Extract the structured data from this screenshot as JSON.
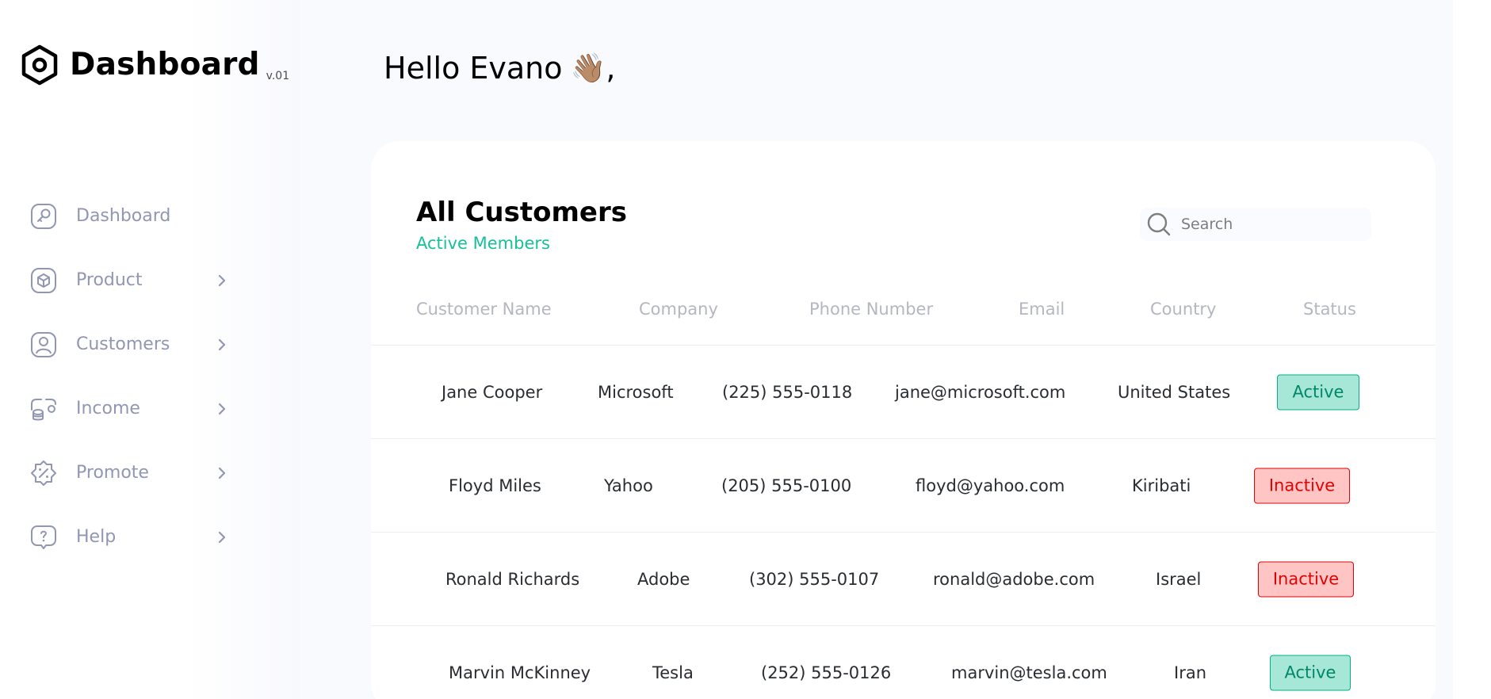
{
  "brand": {
    "title": "Dashboard",
    "version": "v.01"
  },
  "sidebar": {
    "items": [
      {
        "label": "Dashboard",
        "icon": "key-icon",
        "has_submenu": false
      },
      {
        "label": "Product",
        "icon": "cube-icon",
        "has_submenu": true
      },
      {
        "label": "Customers",
        "icon": "user-square-icon",
        "has_submenu": true
      },
      {
        "label": "Income",
        "icon": "wallet-money-icon",
        "has_submenu": true
      },
      {
        "label": "Promote",
        "icon": "discount-shape-icon",
        "has_submenu": true
      },
      {
        "label": "Help",
        "icon": "message-question-icon",
        "has_submenu": true
      }
    ],
    "label_color": "#9197b3"
  },
  "header": {
    "greeting": "Hello Evano",
    "emoji": "👋🏽",
    "suffix": ","
  },
  "customers": {
    "title": "All Customers",
    "subtitle": "Active Members",
    "search_placeholder": "Search",
    "columns": [
      "Customer Name",
      "Company",
      "Phone Number",
      "Email",
      "Country",
      "Status"
    ],
    "rows": [
      {
        "name": "Jane Cooper",
        "company": "Microsoft",
        "phone": "(225) 555-0118",
        "email": "jane@microsoft.com",
        "country": "United States",
        "status": "Active"
      },
      {
        "name": "Floyd Miles",
        "company": "Yahoo",
        "phone": "(205) 555-0100",
        "email": "floyd@yahoo.com",
        "country": "Kiribati",
        "status": "Inactive"
      },
      {
        "name": "Ronald Richards",
        "company": "Adobe",
        "phone": "(302) 555-0107",
        "email": "ronald@adobe.com",
        "country": "Israel",
        "status": "Inactive"
      },
      {
        "name": "Marvin McKinney",
        "company": "Tesla",
        "phone": "(252) 555-0126",
        "email": "marvin@tesla.com",
        "country": "Iran",
        "status": "Active"
      }
    ]
  },
  "colors": {
    "accent": "#16c098",
    "active_bg": "#a6e7d8",
    "active_text": "#008767",
    "inactive_bg": "#ffc5c5",
    "inactive_text": "#df0404"
  }
}
